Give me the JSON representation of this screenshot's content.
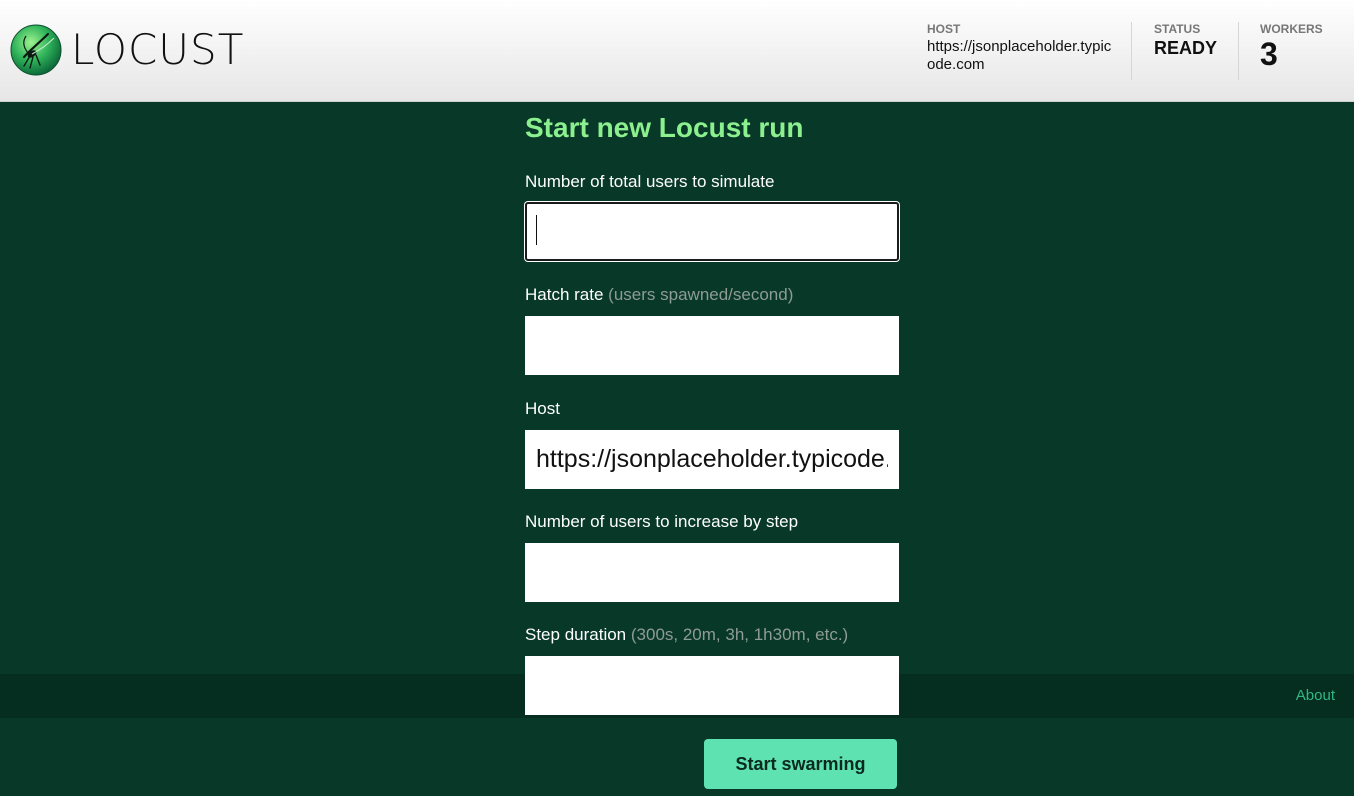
{
  "header": {
    "logo_text": "LOCUST",
    "host_label": "HOST",
    "host_value": "https://jsonplaceholder.typicode.com",
    "status_label": "STATUS",
    "status_value": "READY",
    "workers_label": "WORKERS",
    "workers_value": "3"
  },
  "form": {
    "title": "Start new Locust run",
    "users_label": "Number of total users to simulate",
    "users_value": "",
    "hatch_label": "Hatch rate",
    "hatch_hint": "(users spawned/second)",
    "hatch_value": "",
    "host_label": "Host",
    "host_value": "https://jsonplaceholder.typicode.com",
    "step_users_label": "Number of users to increase by step",
    "step_users_value": "",
    "step_duration_label": "Step duration",
    "step_duration_hint": "(300s, 20m, 3h, 1h30m, etc.)",
    "step_duration_value": "",
    "submit_label": "Start swarming"
  },
  "footer": {
    "about_label": "About"
  },
  "colors": {
    "background": "#073828",
    "title": "#8cf08e",
    "button": "#5fe2b2",
    "link": "#2fb884"
  },
  "icons": {
    "logo": "locust-logo-icon"
  }
}
